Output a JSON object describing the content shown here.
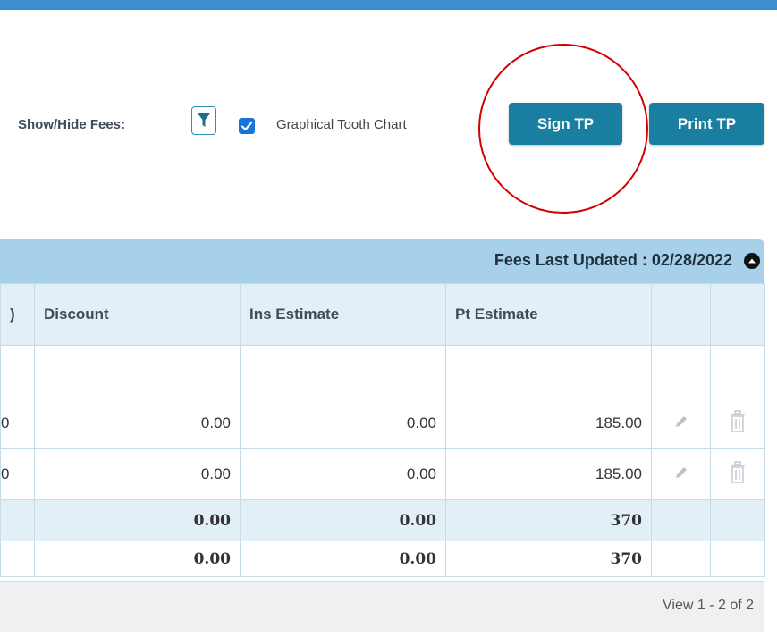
{
  "toolbar": {
    "show_hide_fees_label": "Show/Hide Fees:",
    "filter_icon": "funnel-icon",
    "graphical_tooth_chart_label": "Graphical Tooth Chart",
    "graphical_tooth_chart_checked": true,
    "sign_tp_label": "Sign TP",
    "print_tp_label": "Print TP"
  },
  "grid": {
    "fees_last_updated": "Fees Last Updated : 02/28/2022",
    "columns": [
      ")",
      "Discount",
      "Ins Estimate",
      "Pt Estimate",
      "",
      ""
    ],
    "rows": [
      {
        "partial": "0",
        "discount": "0.00",
        "ins_estimate": "0.00",
        "pt_estimate": "185.00"
      },
      {
        "partial": "0",
        "discount": "0.00",
        "ins_estimate": "0.00",
        "pt_estimate": "185.00"
      }
    ],
    "subtotal": {
      "discount": "0.00",
      "ins_estimate": "0.00",
      "pt_estimate": "370"
    },
    "total": {
      "discount": "0.00",
      "ins_estimate": "0.00",
      "pt_estimate": "370"
    },
    "footer_view": "View 1 - 2 of 2"
  },
  "colors": {
    "topbar": "#3a8fd2",
    "button": "#197ea0",
    "header": "#a7d1ea",
    "annotation_circle": "#d40000"
  }
}
